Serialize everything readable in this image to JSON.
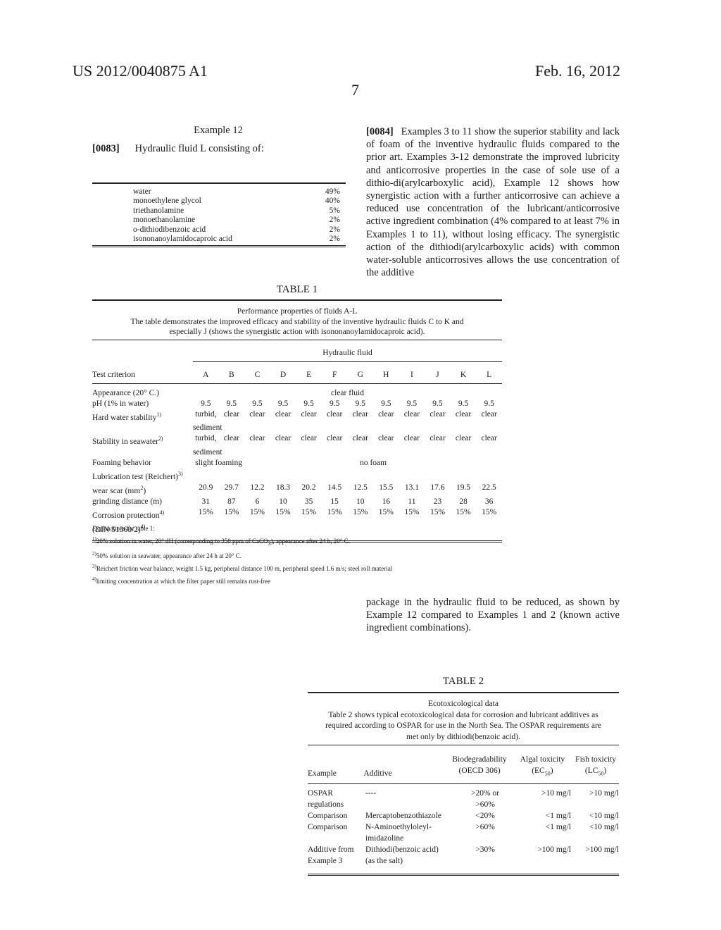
{
  "header": {
    "patent_number": "US 2012/0040875 A1",
    "date": "Feb. 16, 2012",
    "page_number": "7"
  },
  "example12": {
    "title": "Example 12",
    "paragraph_label": "[0083]",
    "paragraph_text": "Hydraulic fluid L consisting of:",
    "components": [
      {
        "name": "water",
        "value": "49%"
      },
      {
        "name": "monoethylene glycol",
        "value": "40%"
      },
      {
        "name": "triethanolamine",
        "value": "5%"
      },
      {
        "name": "monoethanolamine",
        "value": "2%"
      },
      {
        "name": "o-dithiodibenzoic acid",
        "value": "2%"
      },
      {
        "name": "isononanoylamidocaproic acid",
        "value": "2%"
      }
    ]
  },
  "para84": {
    "label": "[0084]",
    "text_part1": "Examples 3 to 11 show the superior stability and lack of foam of the inventive hydraulic fluids compared to the prior art. Examples 3-12 demonstrate the improved lubricity and anticorrosive properties in the case of sole use of a dithio-di(arylcarboxylic acid), Example 12 shows how synergistic action with a further anticorrosive can achieve a reduced use concentration of the lubricant/anticorrosive active ingredient combination (4% compared to at least 7% in Examples 1 to 11), without losing efficacy. The synergistic action of the dithiodi(arylcarboxylic acids) with common water-soluble anticorrosives allows the use concentration of the additive",
    "text_part2": "package in the hydraulic fluid to be reduced, as shown by Example 12 compared to Examples 1 and 2 (known active ingredient combinations)."
  },
  "table1": {
    "title": "TABLE 1",
    "caption_line1": "Performance properties of fluids A-L",
    "caption_line2": "The table demonstrates the improved efficacy and stability of the inventive hydraulic fluids C to K and especially J (shows the synergistic action with isononanoylamidocaproic acid).",
    "group_header": "Hydraulic fluid",
    "criterion_header": "Test criterion",
    "columns": [
      "A",
      "B",
      "C",
      "D",
      "E",
      "F",
      "G",
      "H",
      "I",
      "J",
      "K",
      "L"
    ],
    "rows": {
      "appearance": {
        "label": "Appearance (20° C.)",
        "span_value": "clear fluid"
      },
      "ph": {
        "label": "pH (1% in water)",
        "values": [
          "9.5",
          "9.5",
          "9.5",
          "9.5",
          "9.5",
          "9.5",
          "9.5",
          "9.5",
          "9.5",
          "9.5",
          "9.5",
          "9.5"
        ]
      },
      "hard_water": {
        "label": "Hard water stability",
        "note": "1)",
        "values": [
          "turbid,",
          "clear",
          "clear",
          "clear",
          "clear",
          "clear",
          "clear",
          "clear",
          "clear",
          "clear",
          "clear",
          "clear"
        ],
        "A_line2": "sediment"
      },
      "seawater": {
        "label": "Stability in seawater",
        "note": "2)",
        "values": [
          "turbid,",
          "clear",
          "clear",
          "clear",
          "clear",
          "clear",
          "clear",
          "clear",
          "clear",
          "clear",
          "clear",
          "clear"
        ],
        "A_line2": "sediment"
      },
      "foaming": {
        "label": "Foaming behavior",
        "AB_value": "slight foaming",
        "rest_value": "no foam"
      },
      "lubrication": {
        "label": "Lubrication test (Reichert)",
        "note": "3)"
      },
      "wear_scar": {
        "label": "wear scar (mm",
        "label_sup": "2",
        "label_end": ")",
        "values": [
          "20.9",
          "29.7",
          "12.2",
          "18.3",
          "20.2",
          "14.5",
          "12.5",
          "15.5",
          "13.1",
          "17.6",
          "19.5",
          "22.5"
        ]
      },
      "grinding": {
        "label": "grinding distance (m)",
        "values": [
          "31",
          "87",
          "6",
          "10",
          "35",
          "15",
          "10",
          "16",
          "11",
          "23",
          "28",
          "36"
        ]
      },
      "corrosion": {
        "label": "Corrosion protection",
        "label_line2": "(DIN 51360/2)",
        "note": "4)",
        "values": [
          "15%",
          "15%",
          "15%",
          "15%",
          "15%",
          "15%",
          "15%",
          "15%",
          "15%",
          "15%",
          "15%",
          "15%"
        ]
      }
    },
    "notes_title": "Explanations for table 1:",
    "notes": [
      {
        "mark": "1)",
        "text_a": "20% solution in water, 20° dH (corresponding to 350 ppm of CaCO",
        "sub": "3",
        "text_b": "), appearance after 24 h, 20° C."
      },
      {
        "mark": "2)",
        "text_a": "50% solution in seawater, appearance after 24 h at 20° C."
      },
      {
        "mark": "3)",
        "text_a": "Reichert friction wear balance, weight 1.5 kg, peripheral distance 100 m, peripheral speed 1.6 m/s; steel roll material"
      },
      {
        "mark": "4)",
        "text_a": "limiting concentration at which the filter paper still remains rust-free"
      }
    ]
  },
  "table2": {
    "title": "TABLE 2",
    "caption_line1": "Ecotoxicological data",
    "caption_line2": "Table 2 shows typical ecotoxicological data for corrosion and lubricant additives as required according to OSPAR for use in the North Sea. The OSPAR requirements are met only by dithiodi(benzoic acid).",
    "headers": {
      "example": "Example",
      "additive": "Additive",
      "bio_1": "Biodegradability",
      "bio_2": "(OECD 306)",
      "algal_1": "Algal toxicity",
      "algal_2a": "(EC",
      "algal_sub": "50",
      "algal_2b": ")",
      "fish_1": "Fish toxicity",
      "fish_2a": "(LC",
      "fish_sub": "50",
      "fish_2b": ")"
    },
    "rows": [
      {
        "example": [
          "OSPAR",
          "regulations"
        ],
        "additive": [
          "----"
        ],
        "bio": [
          ">20% or",
          ">60%"
        ],
        "algal": ">10 mg/l",
        "fish": ">10 mg/l"
      },
      {
        "example": [
          "Comparison"
        ],
        "additive": [
          "Mercaptobenzothiazole"
        ],
        "bio": [
          "<20%"
        ],
        "algal": "<1 mg/l",
        "fish": "<10 mg/l"
      },
      {
        "example": [
          "Comparison"
        ],
        "additive": [
          "N-Aminoethyloleyl-",
          "imidazoline"
        ],
        "bio": [
          ">60%"
        ],
        "algal": "<1 mg/l",
        "fish": "<10 mg/l"
      },
      {
        "example": [
          "Additive from",
          "Example 3"
        ],
        "additive": [
          "Dithiodi(benzoic acid)",
          "(as the salt)"
        ],
        "bio": [
          ">30%"
        ],
        "algal": ">100 mg/l",
        "fish": ">100 mg/l"
      }
    ]
  }
}
